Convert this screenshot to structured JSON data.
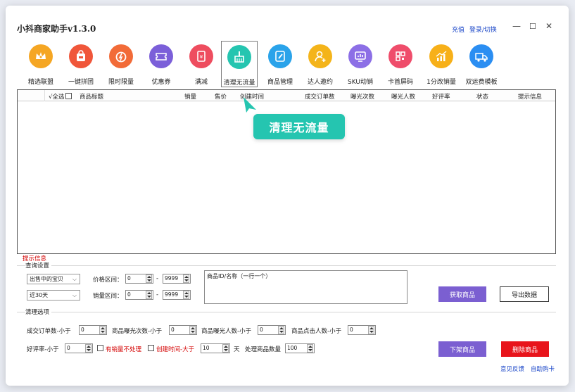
{
  "app": {
    "title": "小抖商家助手v1.3.0",
    "recharge": "充值",
    "login": "登录/切换"
  },
  "toolbar": [
    {
      "label": "精选联盟",
      "icon": "crown-icon",
      "color": "#f5a623"
    },
    {
      "label": "一键拼团",
      "icon": "group-buy-bag-icon",
      "color": "#f0563a"
    },
    {
      "label": "限时限量",
      "icon": "stopwatch-icon",
      "color": "#f26b38"
    },
    {
      "label": "优惠券",
      "icon": "coupon-icon",
      "color": "#7b5fd9"
    },
    {
      "label": "满减",
      "icon": "discount-ticket-icon",
      "color": "#ee4d5f"
    },
    {
      "label": "清理无流量",
      "icon": "broom-icon",
      "color": "#25c5b0"
    },
    {
      "label": "商品管理",
      "icon": "edit-doc-icon",
      "color": "#2aa3ea"
    },
    {
      "label": "达人邀约",
      "icon": "add-person-icon",
      "color": "#f4b41a"
    },
    {
      "label": "SKU动销",
      "icon": "chart-board-icon",
      "color": "#8c6fe6"
    },
    {
      "label": "卡首屏码",
      "icon": "qr-grid-icon",
      "color": "#ef4d6b"
    },
    {
      "label": "1分改销量",
      "icon": "growth-chart-icon",
      "color": "#f7b019"
    },
    {
      "label": "双运费模板",
      "icon": "truck-icon",
      "color": "#2b8ef2"
    }
  ],
  "grid": {
    "columns": [
      "√全选",
      "商品标题",
      "销量",
      "售价",
      "创建时间",
      "成交订单数",
      "曝光次数",
      "曝光人数",
      "好评率",
      "状态",
      "提示信息"
    ]
  },
  "callout": "清理无流量",
  "tip_title": "提示信息",
  "query": {
    "section_label": "查询设置",
    "status_select": "出售中的宝贝",
    "period_select": "近30天",
    "price_label": "价格区间：",
    "price_min": "0",
    "price_max": "9999",
    "sales_label": "销量区间：",
    "sales_min": "0",
    "sales_max": "9999",
    "dash": "-",
    "ids_placeholder": "商品ID/名称（一行一个）",
    "fetch_button": "获取商品",
    "export_button": "导出数据"
  },
  "clean": {
    "section_label": "清理选项",
    "orders_label": "成交订单数-小于",
    "orders_val": "0",
    "exposure_count_label": "商品曝光次数-小于",
    "exposure_count_val": "0",
    "exposure_people_label": "商品曝光人数-小于",
    "exposure_people_val": "0",
    "click_people_label": "商品点击人数-小于",
    "click_people_val": "0",
    "rating_label": "好评率-小于",
    "rating_val": "0",
    "skip_sales_label": "有销量不处理",
    "created_label": "创建时间-大于",
    "created_val": "10",
    "days_unit": "天",
    "batch_label": "处理商品数量",
    "batch_val": "100",
    "delist_button": "下架商品",
    "delete_button": "删除商品"
  },
  "footer": {
    "feedback": "意见反馈",
    "help": "自助购卡"
  },
  "colors": {
    "purple": "#7b5fd1",
    "red": "#e8141b",
    "link": "#1a46c8",
    "teal": "#25c5b0"
  }
}
